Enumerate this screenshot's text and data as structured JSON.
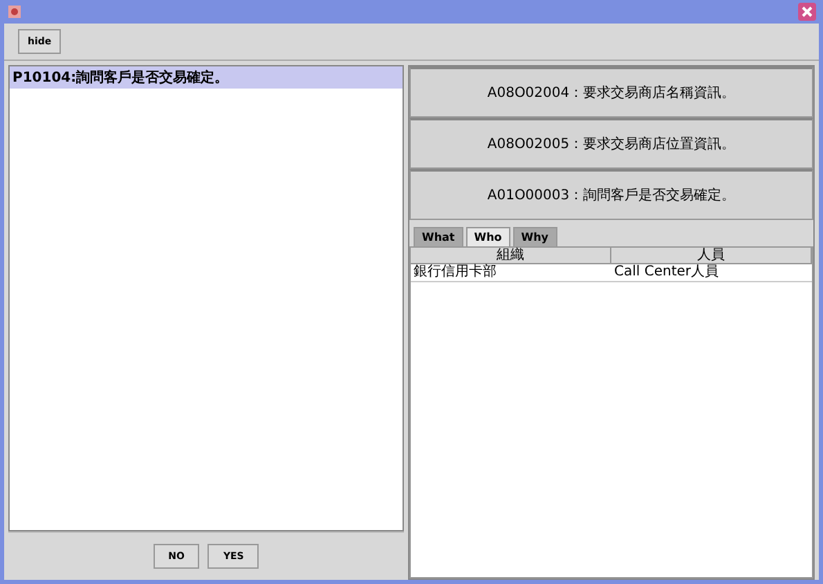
{
  "toolbar": {
    "hide_button": "hide"
  },
  "left_list": {
    "items": [
      {
        "label": "P10104:詢問客戶是否交易確定。",
        "selected": true
      }
    ]
  },
  "left_buttons": [
    "NO",
    "YES"
  ],
  "actions": [
    "A08O02004：要求交易商店名稱資訊。",
    "A08O02005：要求交易商店位置資訊。",
    "A01O00003：詢問客戶是否交易確定。"
  ],
  "tabs": [
    {
      "label": "What",
      "selected": false
    },
    {
      "label": "Who",
      "selected": true
    },
    {
      "label": "Why",
      "selected": false
    }
  ],
  "table": {
    "columns": [
      "組織",
      "人員"
    ],
    "rows": [
      [
        "銀行信用卡部",
        "Call Center人員"
      ]
    ]
  }
}
